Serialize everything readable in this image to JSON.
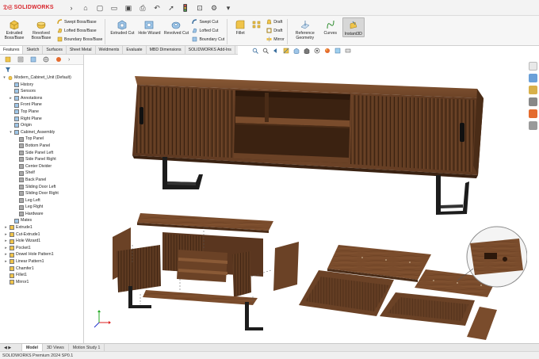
{
  "app": {
    "brand": "SOLIDWORKS",
    "status_text": "SOLIDWORKS Premium 2024 SP0.1"
  },
  "ribbon": {
    "extruded_boss": "Extruded Boss/Base",
    "revolved_boss": "Revolved Boss/Base",
    "swept_boss": "Swept Boss/Base",
    "lofted_boss": "Lofted Boss/Base",
    "boundary_boss": "Boundary Boss/Base",
    "extruded_cut": "Extruded Cut",
    "hole_wizard": "Hole Wizard",
    "revolved_cut": "Revolved Cut",
    "swept_cut": "Swept Cut",
    "lofted_cut": "Lofted Cut",
    "boundary_cut": "Boundary Cut",
    "fillet": "Fillet",
    "linear_pattern": "Linear Pattern",
    "draft": "Draft",
    "shell": "Draft",
    "mirror": "Mirror",
    "reference_geometry": "Reference Geometry",
    "curves": "Curves",
    "instant3d": "Instant3D"
  },
  "command_tabs": [
    "Features",
    "Sketch",
    "Surfaces",
    "Sheet Metal",
    "Weldments",
    "Evaluate",
    "MBD Dimensions",
    "SOLIDWORKS Add-Ins"
  ],
  "tree": {
    "root": "Modern_Cabinet_Unit (Default)",
    "items": [
      {
        "label": "History",
        "indent": 1,
        "exp": ""
      },
      {
        "label": "Sensors",
        "indent": 1,
        "exp": ""
      },
      {
        "label": "Annotations",
        "indent": 1,
        "exp": "▸"
      },
      {
        "label": "Front Plane",
        "indent": 1,
        "exp": ""
      },
      {
        "label": "Top Plane",
        "indent": 1,
        "exp": ""
      },
      {
        "label": "Right Plane",
        "indent": 1,
        "exp": ""
      },
      {
        "label": "Origin",
        "indent": 1,
        "exp": ""
      },
      {
        "label": "Cabinet_Assembly",
        "indent": 1,
        "exp": "▾"
      },
      {
        "label": "Top Panel",
        "indent": 2,
        "exp": ""
      },
      {
        "label": "Bottom Panel",
        "indent": 2,
        "exp": ""
      },
      {
        "label": "Side Panel Left",
        "indent": 2,
        "exp": ""
      },
      {
        "label": "Side Panel Right",
        "indent": 2,
        "exp": ""
      },
      {
        "label": "Center Divider",
        "indent": 2,
        "exp": ""
      },
      {
        "label": "Shelf",
        "indent": 2,
        "exp": ""
      },
      {
        "label": "Back Panel",
        "indent": 2,
        "exp": ""
      },
      {
        "label": "Sliding Door Left",
        "indent": 2,
        "exp": ""
      },
      {
        "label": "Sliding Door Right",
        "indent": 2,
        "exp": ""
      },
      {
        "label": "Leg Left",
        "indent": 2,
        "exp": ""
      },
      {
        "label": "Leg Right",
        "indent": 2,
        "exp": ""
      },
      {
        "label": "Hardware",
        "indent": 2,
        "exp": ""
      },
      {
        "label": "Mates",
        "indent": 1,
        "exp": ""
      },
      {
        "label": "Extrude1",
        "indent": 0,
        "exp": "▸"
      },
      {
        "label": "Cut-Extrude1",
        "indent": 0,
        "exp": "▸"
      },
      {
        "label": "Hole Wizard1",
        "indent": 0,
        "exp": "▸"
      },
      {
        "label": "Pocket1",
        "indent": 0,
        "exp": "▸"
      },
      {
        "label": "Dowel Hole Pattern1",
        "indent": 0,
        "exp": "▸"
      },
      {
        "label": "Linear Pattern1",
        "indent": 0,
        "exp": "▸"
      },
      {
        "label": "Chamfer1",
        "indent": 0,
        "exp": ""
      },
      {
        "label": "Fillet1",
        "indent": 0,
        "exp": ""
      },
      {
        "label": "Mirror1",
        "indent": 0,
        "exp": ""
      }
    ]
  },
  "bottom_tabs": [
    "Model",
    "3D Views",
    "Motion Study 1"
  ],
  "colors": {
    "wood": "#6b4226",
    "wood_dark": "#4a2c17",
    "wood_light": "#8a5a36",
    "metal": "#1c1c1c",
    "brand_red": "#d8232a",
    "axis_x": "#d22",
    "axis_y": "#2a2",
    "axis_z": "#23c"
  }
}
